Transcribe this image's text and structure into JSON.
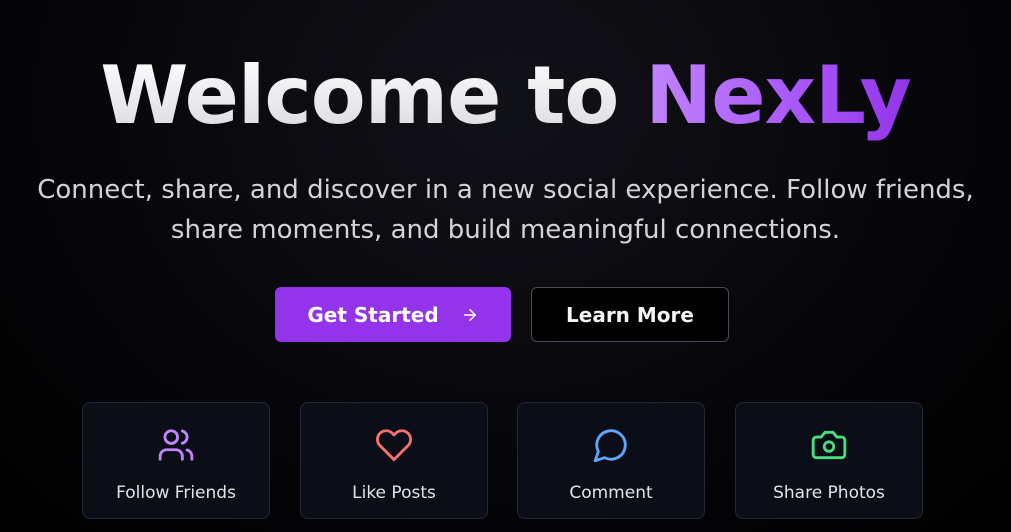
{
  "hero": {
    "title_prefix": "Welcome to ",
    "title_brand": "NexLy",
    "subtitle_line1": "Connect, share, and discover in a new social experience. Follow friends,",
    "subtitle_line2": "share moments, and build meaningful connections."
  },
  "actions": {
    "primary_label": "Get Started",
    "primary_icon": "arrow-right-icon",
    "secondary_label": "Learn More"
  },
  "features": [
    {
      "label": "Follow Friends",
      "icon": "users-icon",
      "color": "#c084fc"
    },
    {
      "label": "Like Posts",
      "icon": "heart-icon",
      "color": "#f87171"
    },
    {
      "label": "Comment",
      "icon": "message-circle-icon",
      "color": "#60a5fa"
    },
    {
      "label": "Share Photos",
      "icon": "camera-icon",
      "color": "#4ade80"
    }
  ],
  "colors": {
    "background": "#000000",
    "accent": "#9333ea",
    "brand_gradient_start": "#c084fc",
    "brand_gradient_end": "#9333ea",
    "card_bg": "#0b0e16"
  }
}
